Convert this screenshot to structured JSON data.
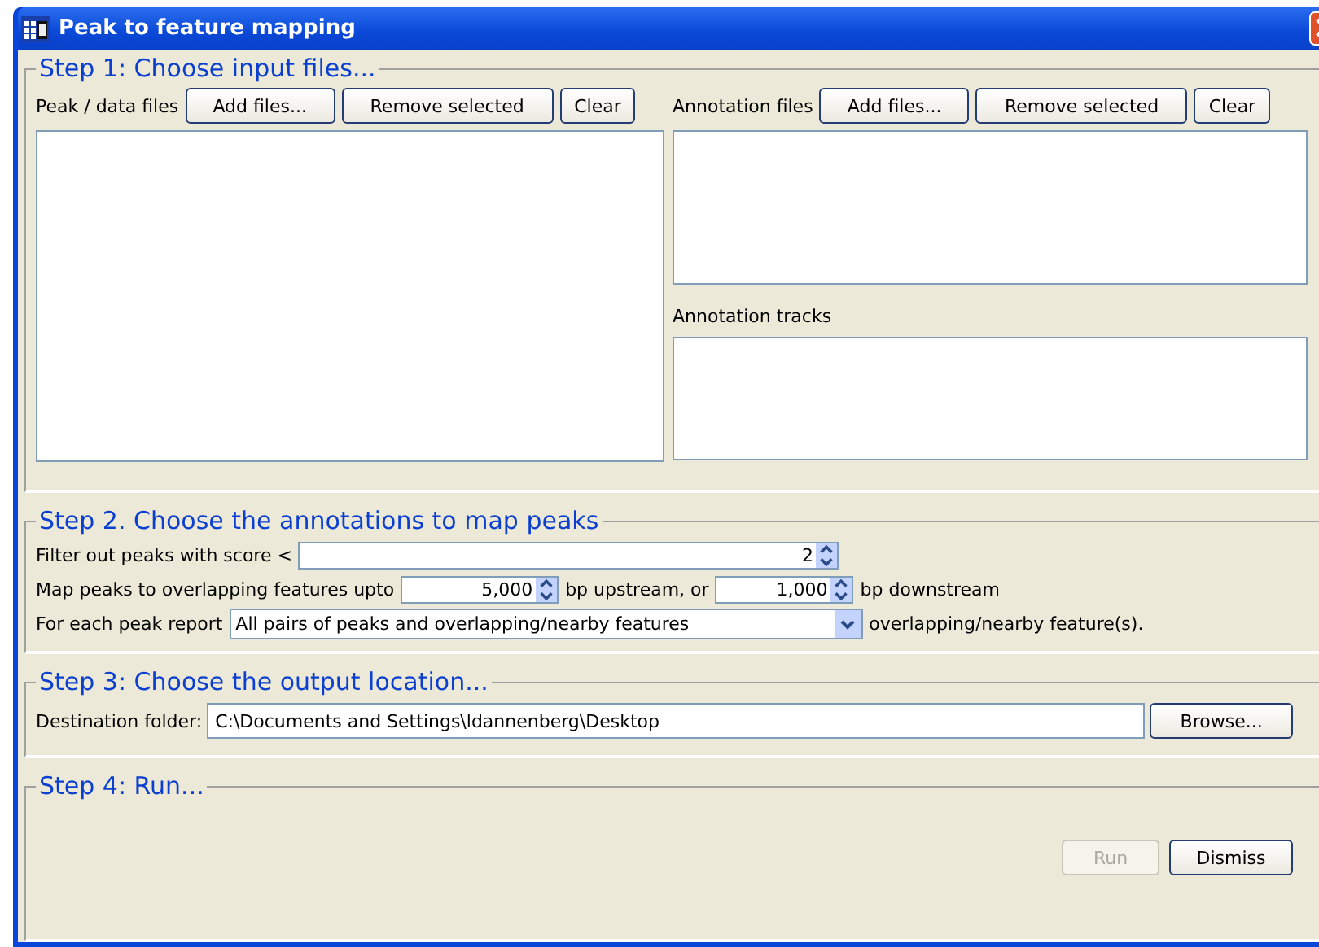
{
  "window": {
    "title": "Peak to feature mapping"
  },
  "step1": {
    "title": "Step 1: Choose input files...",
    "peak_files": {
      "label": "Peak / data files",
      "buttons": [
        "Add files...",
        "Remove selected",
        "Clear"
      ]
    },
    "annotation_files": {
      "label": "Annotation files",
      "buttons": [
        "Add files...",
        "Remove selected",
        "Clear"
      ]
    },
    "annotation_tracks": {
      "label": "Annotation tracks"
    }
  },
  "step2": {
    "title": "Step 2. Choose the annotations to map peaks",
    "filter": {
      "label": "Filter out peaks with score <",
      "value": "2"
    },
    "map": {
      "label": "Map peaks to overlapping features upto",
      "upstream": "5,000",
      "upstream_suffix": "bp upstream, or",
      "downstream": "1,000",
      "downstream_suffix": "bp downstream"
    },
    "report": {
      "label": "For each peak report",
      "value": "All pairs of peaks and overlapping/nearby features",
      "suffix": "overlapping/nearby feature(s)."
    }
  },
  "step3": {
    "title": "Step 3: Choose the output location...",
    "label": "Destination folder:",
    "value": "C:\\Documents and Settings\\ldannenberg\\Desktop",
    "button": "Browse..."
  },
  "step4": {
    "title": "Step 4: Run...",
    "buttons": [
      {
        "label": "Run",
        "disabled": true
      },
      {
        "label": "Dismiss",
        "disabled": false
      }
    ]
  }
}
